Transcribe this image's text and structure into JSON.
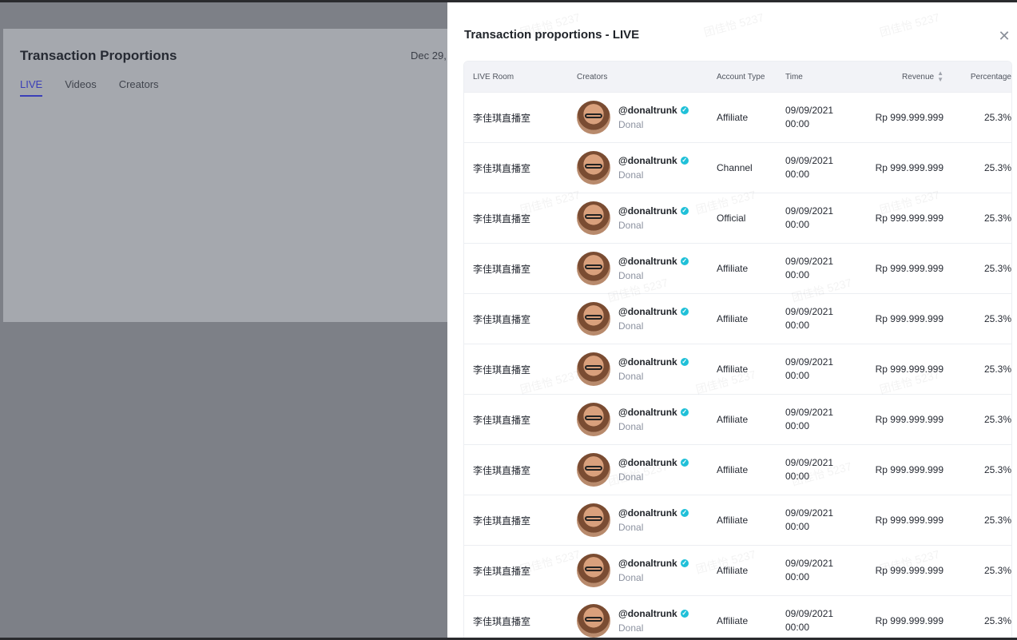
{
  "background_page": {
    "title": "Transaction Proportions",
    "date": "Dec 29,",
    "tabs": [
      {
        "label": "LIVE",
        "active": true
      },
      {
        "label": "Videos",
        "active": false
      },
      {
        "label": "Creators",
        "active": false
      }
    ]
  },
  "drawer": {
    "title": "Transaction proportions - LIVE",
    "close_icon": "close-icon",
    "columns": {
      "live_room": "LIVE Room",
      "creators": "Creators",
      "account_type": "Account Type",
      "time": "Time",
      "revenue": "Revenue",
      "percentage": "Percentage"
    },
    "rows": [
      {
        "room": "李佳琪直播室",
        "handle": "@donaltrunk",
        "name": "Donal",
        "type": "Affiliate",
        "date": "09/09/2021",
        "time": "00:00",
        "revenue": "Rp 999.999.999",
        "pct": "25.3%"
      },
      {
        "room": "李佳琪直播室",
        "handle": "@donaltrunk",
        "name": "Donal",
        "type": "Channel",
        "date": "09/09/2021",
        "time": "00:00",
        "revenue": "Rp 999.999.999",
        "pct": "25.3%"
      },
      {
        "room": "李佳琪直播室",
        "handle": "@donaltrunk",
        "name": "Donal",
        "type": "Official",
        "date": "09/09/2021",
        "time": "00:00",
        "revenue": "Rp 999.999.999",
        "pct": "25.3%"
      },
      {
        "room": "李佳琪直播室",
        "handle": "@donaltrunk",
        "name": "Donal",
        "type": "Affiliate",
        "date": "09/09/2021",
        "time": "00:00",
        "revenue": "Rp 999.999.999",
        "pct": "25.3%"
      },
      {
        "room": "李佳琪直播室",
        "handle": "@donaltrunk",
        "name": "Donal",
        "type": "Affiliate",
        "date": "09/09/2021",
        "time": "00:00",
        "revenue": "Rp 999.999.999",
        "pct": "25.3%"
      },
      {
        "room": "李佳琪直播室",
        "handle": "@donaltrunk",
        "name": "Donal",
        "type": "Affiliate",
        "date": "09/09/2021",
        "time": "00:00",
        "revenue": "Rp 999.999.999",
        "pct": "25.3%"
      },
      {
        "room": "李佳琪直播室",
        "handle": "@donaltrunk",
        "name": "Donal",
        "type": "Affiliate",
        "date": "09/09/2021",
        "time": "00:00",
        "revenue": "Rp 999.999.999",
        "pct": "25.3%"
      },
      {
        "room": "李佳琪直播室",
        "handle": "@donaltrunk",
        "name": "Donal",
        "type": "Affiliate",
        "date": "09/09/2021",
        "time": "00:00",
        "revenue": "Rp 999.999.999",
        "pct": "25.3%"
      },
      {
        "room": "李佳琪直播室",
        "handle": "@donaltrunk",
        "name": "Donal",
        "type": "Affiliate",
        "date": "09/09/2021",
        "time": "00:00",
        "revenue": "Rp 999.999.999",
        "pct": "25.3%"
      },
      {
        "room": "李佳琪直播室",
        "handle": "@donaltrunk",
        "name": "Donal",
        "type": "Affiliate",
        "date": "09/09/2021",
        "time": "00:00",
        "revenue": "Rp 999.999.999",
        "pct": "25.3%"
      },
      {
        "room": "李佳琪直播室",
        "handle": "@donaltrunk",
        "name": "Donal",
        "type": "Affiliate",
        "date": "09/09/2021",
        "time": "00:00",
        "revenue": "Rp 999.999.999",
        "pct": "25.3%"
      }
    ]
  },
  "watermark_text": "团佳怡 5237"
}
